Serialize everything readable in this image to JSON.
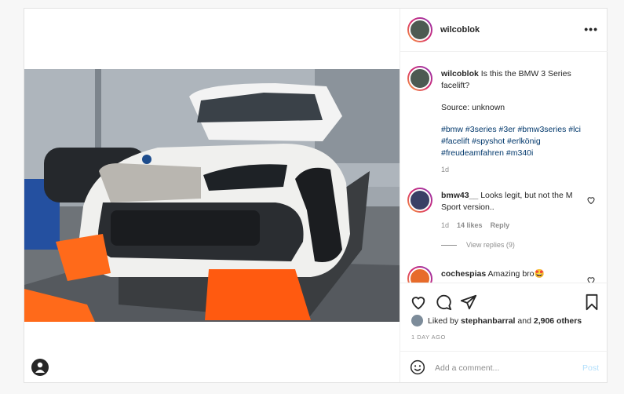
{
  "post": {
    "username": "wilcoblok",
    "more_label": "•••"
  },
  "caption": {
    "username": "wilcoblok",
    "text": "Is this the BMW 3 Series facelift?",
    "source": "Source: unknown",
    "hashtags": "#bmw #3series #3er #bmw3series #lci #facelift #spyshot #erlkönig #freudeamfahren #m340i",
    "time": "1d"
  },
  "comments": [
    {
      "username": "bmw43__",
      "text": "Looks legit, but not the M Sport version..",
      "time": "1d",
      "likes": "14 likes",
      "reply": "Reply",
      "view_replies": "View replies (9)"
    },
    {
      "username": "cochespias",
      "text": "Amazing bro🤩"
    }
  ],
  "likes": {
    "prefix": "Liked by",
    "user": "stephanbarral",
    "conj": "and",
    "count": "2,906 others"
  },
  "time_ago": "1 DAY AGO",
  "add_comment": {
    "placeholder": "Add a comment...",
    "post_label": "Post"
  },
  "icons": [
    "heart-icon",
    "comment-icon",
    "share-icon",
    "bookmark-icon",
    "emoji-icon",
    "more-icon"
  ]
}
